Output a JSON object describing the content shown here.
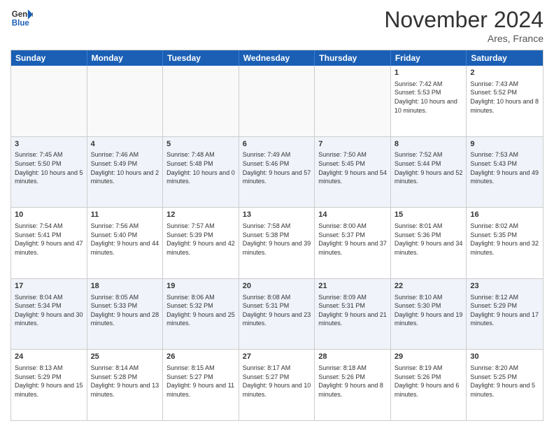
{
  "header": {
    "logo_line1": "General",
    "logo_line2": "Blue",
    "month": "November 2024",
    "location": "Ares, France"
  },
  "days_of_week": [
    "Sunday",
    "Monday",
    "Tuesday",
    "Wednesday",
    "Thursday",
    "Friday",
    "Saturday"
  ],
  "rows": [
    {
      "alt": false,
      "cells": [
        {
          "day": "",
          "text": ""
        },
        {
          "day": "",
          "text": ""
        },
        {
          "day": "",
          "text": ""
        },
        {
          "day": "",
          "text": ""
        },
        {
          "day": "",
          "text": ""
        },
        {
          "day": "1",
          "text": "Sunrise: 7:42 AM\nSunset: 5:53 PM\nDaylight: 10 hours and 10 minutes."
        },
        {
          "day": "2",
          "text": "Sunrise: 7:43 AM\nSunset: 5:52 PM\nDaylight: 10 hours and 8 minutes."
        }
      ]
    },
    {
      "alt": true,
      "cells": [
        {
          "day": "3",
          "text": "Sunrise: 7:45 AM\nSunset: 5:50 PM\nDaylight: 10 hours and 5 minutes."
        },
        {
          "day": "4",
          "text": "Sunrise: 7:46 AM\nSunset: 5:49 PM\nDaylight: 10 hours and 2 minutes."
        },
        {
          "day": "5",
          "text": "Sunrise: 7:48 AM\nSunset: 5:48 PM\nDaylight: 10 hours and 0 minutes."
        },
        {
          "day": "6",
          "text": "Sunrise: 7:49 AM\nSunset: 5:46 PM\nDaylight: 9 hours and 57 minutes."
        },
        {
          "day": "7",
          "text": "Sunrise: 7:50 AM\nSunset: 5:45 PM\nDaylight: 9 hours and 54 minutes."
        },
        {
          "day": "8",
          "text": "Sunrise: 7:52 AM\nSunset: 5:44 PM\nDaylight: 9 hours and 52 minutes."
        },
        {
          "day": "9",
          "text": "Sunrise: 7:53 AM\nSunset: 5:43 PM\nDaylight: 9 hours and 49 minutes."
        }
      ]
    },
    {
      "alt": false,
      "cells": [
        {
          "day": "10",
          "text": "Sunrise: 7:54 AM\nSunset: 5:41 PM\nDaylight: 9 hours and 47 minutes."
        },
        {
          "day": "11",
          "text": "Sunrise: 7:56 AM\nSunset: 5:40 PM\nDaylight: 9 hours and 44 minutes."
        },
        {
          "day": "12",
          "text": "Sunrise: 7:57 AM\nSunset: 5:39 PM\nDaylight: 9 hours and 42 minutes."
        },
        {
          "day": "13",
          "text": "Sunrise: 7:58 AM\nSunset: 5:38 PM\nDaylight: 9 hours and 39 minutes."
        },
        {
          "day": "14",
          "text": "Sunrise: 8:00 AM\nSunset: 5:37 PM\nDaylight: 9 hours and 37 minutes."
        },
        {
          "day": "15",
          "text": "Sunrise: 8:01 AM\nSunset: 5:36 PM\nDaylight: 9 hours and 34 minutes."
        },
        {
          "day": "16",
          "text": "Sunrise: 8:02 AM\nSunset: 5:35 PM\nDaylight: 9 hours and 32 minutes."
        }
      ]
    },
    {
      "alt": true,
      "cells": [
        {
          "day": "17",
          "text": "Sunrise: 8:04 AM\nSunset: 5:34 PM\nDaylight: 9 hours and 30 minutes."
        },
        {
          "day": "18",
          "text": "Sunrise: 8:05 AM\nSunset: 5:33 PM\nDaylight: 9 hours and 28 minutes."
        },
        {
          "day": "19",
          "text": "Sunrise: 8:06 AM\nSunset: 5:32 PM\nDaylight: 9 hours and 25 minutes."
        },
        {
          "day": "20",
          "text": "Sunrise: 8:08 AM\nSunset: 5:31 PM\nDaylight: 9 hours and 23 minutes."
        },
        {
          "day": "21",
          "text": "Sunrise: 8:09 AM\nSunset: 5:31 PM\nDaylight: 9 hours and 21 minutes."
        },
        {
          "day": "22",
          "text": "Sunrise: 8:10 AM\nSunset: 5:30 PM\nDaylight: 9 hours and 19 minutes."
        },
        {
          "day": "23",
          "text": "Sunrise: 8:12 AM\nSunset: 5:29 PM\nDaylight: 9 hours and 17 minutes."
        }
      ]
    },
    {
      "alt": false,
      "cells": [
        {
          "day": "24",
          "text": "Sunrise: 8:13 AM\nSunset: 5:29 PM\nDaylight: 9 hours and 15 minutes."
        },
        {
          "day": "25",
          "text": "Sunrise: 8:14 AM\nSunset: 5:28 PM\nDaylight: 9 hours and 13 minutes."
        },
        {
          "day": "26",
          "text": "Sunrise: 8:15 AM\nSunset: 5:27 PM\nDaylight: 9 hours and 11 minutes."
        },
        {
          "day": "27",
          "text": "Sunrise: 8:17 AM\nSunset: 5:27 PM\nDaylight: 9 hours and 10 minutes."
        },
        {
          "day": "28",
          "text": "Sunrise: 8:18 AM\nSunset: 5:26 PM\nDaylight: 9 hours and 8 minutes."
        },
        {
          "day": "29",
          "text": "Sunrise: 8:19 AM\nSunset: 5:26 PM\nDaylight: 9 hours and 6 minutes."
        },
        {
          "day": "30",
          "text": "Sunrise: 8:20 AM\nSunset: 5:25 PM\nDaylight: 9 hours and 5 minutes."
        }
      ]
    }
  ]
}
